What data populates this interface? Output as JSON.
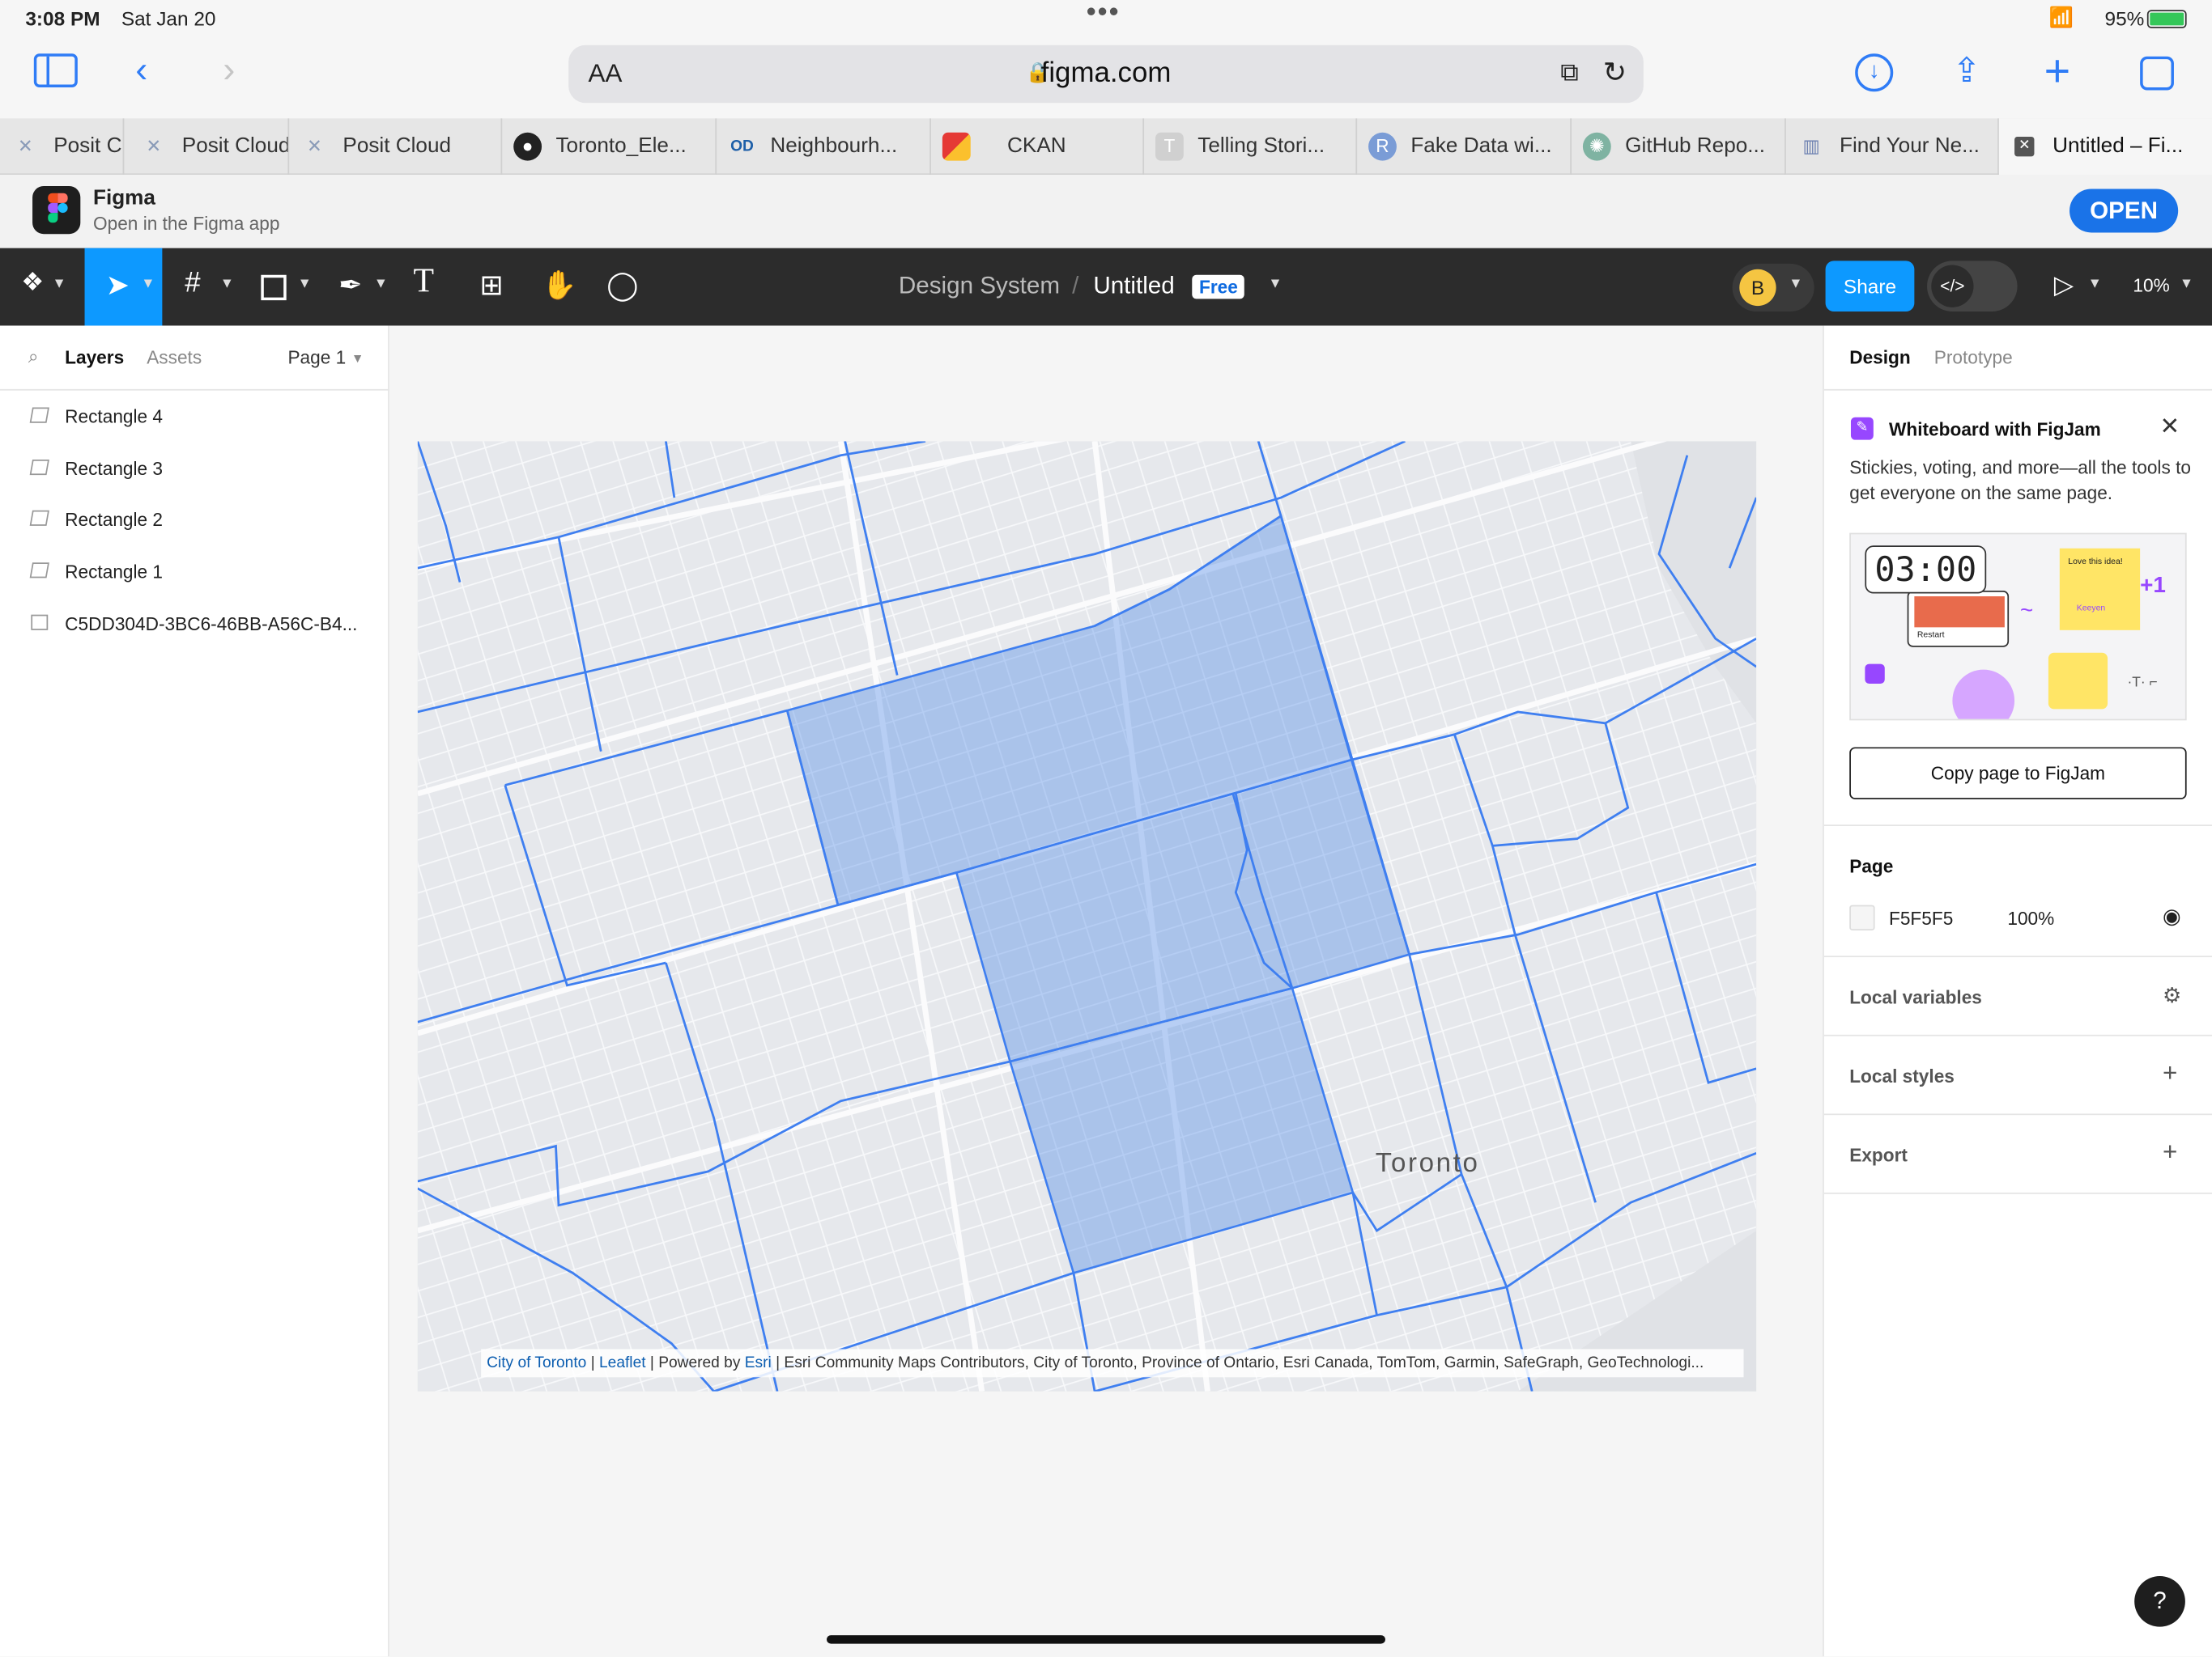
{
  "status_bar": {
    "time": "3:08 PM",
    "date": "Sat Jan 20",
    "battery": "95%"
  },
  "browser": {
    "text_size_label": "AA",
    "url": "figma.com",
    "tabs": [
      {
        "title": "Posit C",
        "icon": "posit-icon"
      },
      {
        "title": "Posit Cloud",
        "icon": "posit-icon"
      },
      {
        "title": "Posit Cloud",
        "icon": "posit-icon"
      },
      {
        "title": "Toronto_Ele...",
        "icon": "github-icon"
      },
      {
        "title": "Neighbourh...",
        "icon": "od-icon"
      },
      {
        "title": "CKAN",
        "icon": "ckan-icon"
      },
      {
        "title": "Telling Stori...",
        "icon": "t-icon"
      },
      {
        "title": "Fake Data wi...",
        "icon": "r-icon"
      },
      {
        "title": "GitHub Repo...",
        "icon": "chatgpt-icon"
      },
      {
        "title": "Find Your Ne...",
        "icon": "chart-icon"
      },
      {
        "title": "Untitled – Fi...",
        "icon": "close-icon"
      }
    ]
  },
  "app_banner": {
    "title": "Figma",
    "subtitle": "Open in the Figma app",
    "open_label": "OPEN"
  },
  "toolbar": {
    "project": "Design System",
    "separator": "/",
    "file_name": "Untitled",
    "plan_badge": "Free",
    "avatar_initial": "B",
    "share_label": "Share",
    "zoom": "10%"
  },
  "left_panel": {
    "tab_layers": "Layers",
    "tab_assets": "Assets",
    "page_selector": "Page 1",
    "layers": [
      {
        "name": "Rectangle 4",
        "icon": "rectangle-icon"
      },
      {
        "name": "Rectangle 3",
        "icon": "rectangle-icon"
      },
      {
        "name": "Rectangle 2",
        "icon": "rectangle-icon"
      },
      {
        "name": "Rectangle 1",
        "icon": "rectangle-icon"
      },
      {
        "name": "C5DD304D-3BC6-46BB-A56C-B4...",
        "icon": "image-icon"
      }
    ]
  },
  "canvas": {
    "map_label": "Toronto",
    "attribution": {
      "link1": "City of Toronto",
      "sep1": "|",
      "link2": "Leaflet",
      "mid": "| Powered by",
      "link3": "Esri",
      "rest": "| Esri Community Maps Contributors, City of Toronto, Province of Ontario, Esri Canada, TomTom, Garmin, SafeGraph, GeoTechnologi..."
    },
    "highlight_color": "#4a86e8",
    "boundary_color": "#3f7ff0"
  },
  "right_panel": {
    "tab_design": "Design",
    "tab_prototype": "Prototype",
    "figjam_promo": {
      "title": "Whiteboard with FigJam",
      "description": "Stickies, voting, and more—all the tools to get everyone on the same page.",
      "timer": "03:00",
      "sticky_text": "Love this idea!",
      "plus_badge": "+1",
      "author": "Keeyen",
      "restart": "Restart",
      "button_label": "Copy page to FigJam"
    },
    "page_section": {
      "title": "Page",
      "color_hex": "F5F5F5",
      "opacity": "100%"
    },
    "local_variables": "Local variables",
    "local_styles": "Local styles",
    "export": "Export"
  },
  "help_label": "?"
}
